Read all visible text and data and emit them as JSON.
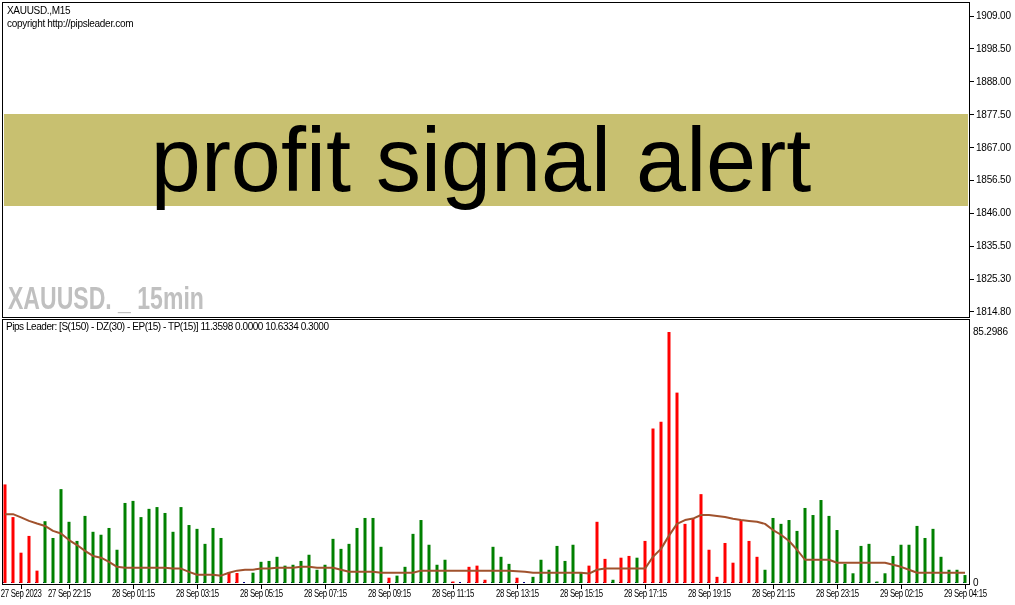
{
  "main_pane": {
    "symbol": "XAUUSD.,M15",
    "copyright": "copyright http://pipsleader.com",
    "banner": {
      "text": "profit signal alert"
    },
    "caption": "XAUUSD. _ 15min",
    "price_axis": {
      "labels": [
        "1909.00",
        "1898.50",
        "1888.00",
        "1877.50",
        "1867.00",
        "1856.50",
        "1846.00",
        "1835.50",
        "1825.30",
        "1814.80"
      ]
    }
  },
  "indicator_pane": {
    "label": "Pips Leader: [S(150) - DZ(30) - EP(15) - TP(15)] 11.3598 0.0000 10.6334 0.3000",
    "chart_data": {
      "type": "bar",
      "ylim": [
        -0.68,
        89.72
      ],
      "yticks": [
        {
          "value": 85.2986,
          "label": "85.2986"
        },
        {
          "value": 0,
          "label": "0"
        }
      ],
      "categories": [
        null,
        null,
        "27 Sep 2023",
        null,
        null,
        null,
        null,
        null,
        "27 Sep 22:15",
        null,
        null,
        null,
        null,
        null,
        null,
        null,
        "28 Sep 01:15",
        null,
        null,
        null,
        null,
        null,
        null,
        null,
        "28 Sep 03:15",
        null,
        null,
        null,
        null,
        null,
        null,
        null,
        "28 Sep 05:15",
        null,
        null,
        null,
        null,
        null,
        null,
        null,
        "28 Sep 07:15",
        null,
        null,
        null,
        null,
        null,
        null,
        null,
        "28 Sep 09:15",
        null,
        null,
        null,
        null,
        null,
        null,
        null,
        "28 Sep 11:15",
        null,
        null,
        null,
        null,
        null,
        null,
        null,
        "28 Sep 13:15",
        null,
        null,
        null,
        null,
        null,
        null,
        null,
        "28 Sep 15:15",
        null,
        null,
        null,
        null,
        null,
        null,
        null,
        "28 Sep 17:15",
        null,
        null,
        null,
        null,
        null,
        null,
        null,
        "28 Sep 19:15",
        null,
        null,
        null,
        null,
        null,
        null,
        null,
        "28 Sep 21:15",
        null,
        null,
        null,
        null,
        null,
        null,
        null,
        "28 Sep 23:15",
        null,
        null,
        null,
        null,
        null,
        null,
        null,
        "29 Sep 02:15",
        null,
        null,
        null,
        null,
        null,
        null,
        null,
        "29 Sep 04:15"
      ],
      "series": [
        {
          "type": "bar",
          "color": "#008000",
          "values": [
            null,
            null,
            null,
            null,
            null,
            21.0,
            15.3,
            31.9,
            20.8,
            14.3,
            22.8,
            17.4,
            16.4,
            18.7,
            11.3,
            27.2,
            27.9,
            22.4,
            25.2,
            25.8,
            23.8,
            17.4,
            25.8,
            19.7,
            18.4,
            13.3,
            18.7,
            15.3,
            null,
            null,
            null,
            3.5,
            7.2,
            7.5,
            8.9,
            5.9,
            6.2,
            7.5,
            9.6,
            4.5,
            6.2,
            15.0,
            11.6,
            13.3,
            18.7,
            22.1,
            22.1,
            12.3,
            null,
            2.5,
            5.5,
            16.7,
            21.4,
            13.0,
            6.2,
            7.9,
            null,
            null,
            null,
            null,
            null,
            12.3,
            8.9,
            6.5,
            null,
            null,
            2.1,
            7.9,
            4.5,
            12.6,
            7.5,
            13.0,
            3.5,
            null,
            null,
            null,
            1.1,
            null,
            null,
            8.6,
            null,
            null,
            null,
            null,
            null,
            null,
            null,
            null,
            null,
            null,
            null,
            null,
            null,
            null,
            null,
            4.5,
            22.1,
            20.1,
            21.4,
            17.7,
            25.5,
            23.1,
            28.2,
            22.8,
            18.0,
            6.5,
            3.3,
            12.6,
            13.3,
            0.5,
            3.3,
            9.2,
            13.0,
            13.0,
            19.4,
            15.3,
            18.4,
            8.9,
            4.5,
            4.5,
            2.7
          ]
        },
        {
          "type": "bar",
          "color": "#ff0000",
          "values": [
            33.5,
            22.4,
            10.3,
            16.0,
            4.2,
            null,
            null,
            null,
            null,
            null,
            null,
            null,
            null,
            null,
            null,
            null,
            null,
            null,
            null,
            null,
            null,
            null,
            null,
            null,
            null,
            null,
            null,
            null,
            3.7,
            3.4,
            null,
            null,
            null,
            null,
            null,
            null,
            null,
            null,
            null,
            null,
            null,
            null,
            null,
            null,
            null,
            null,
            null,
            null,
            1.8,
            null,
            null,
            null,
            null,
            null,
            null,
            null,
            0.5,
            null,
            5.5,
            5.9,
            1.1,
            null,
            null,
            null,
            1.8,
            null,
            null,
            null,
            null,
            null,
            null,
            null,
            null,
            5.9,
            20.8,
            8.2,
            null,
            8.6,
            9.2,
            null,
            14.3,
            52.5,
            54.8,
            85.3,
            64.7,
            20.1,
            21.8,
            30.2,
            11.3,
            2.1,
            13.6,
            6.9,
            21.4,
            14.3,
            8.9,
            null,
            null,
            null,
            null,
            null,
            null,
            null,
            null,
            null,
            null,
            null,
            null,
            null,
            null,
            null,
            null,
            null,
            null,
            null,
            null,
            null,
            null,
            null,
            null,
            null,
            null
          ]
        },
        {
          "type": "line",
          "color": "#a0522d",
          "values": [
            23.4,
            23.4,
            22.3,
            21.1,
            20.2,
            19.4,
            17.7,
            16.8,
            14.6,
            12.9,
            10.9,
            9.2,
            8.6,
            7.2,
            5.5,
            5.2,
            5.2,
            5.2,
            5.2,
            5.2,
            5.2,
            4.9,
            4.9,
            3.8,
            2.8,
            2.8,
            2.8,
            2.5,
            3.5,
            4.2,
            4.5,
            4.5,
            4.9,
            4.9,
            5.2,
            5.2,
            5.2,
            5.5,
            5.5,
            5.2,
            5.2,
            5.2,
            4.5,
            3.8,
            3.8,
            3.8,
            3.8,
            3.5,
            3.5,
            3.5,
            3.5,
            3.5,
            4.2,
            4.2,
            4.2,
            4.2,
            4.2,
            4.2,
            4.2,
            4.2,
            4.2,
            4.2,
            4.2,
            4.2,
            4.0,
            3.8,
            3.5,
            3.5,
            3.5,
            3.5,
            3.5,
            3.5,
            3.5,
            3.2,
            4.5,
            4.9,
            4.9,
            4.9,
            4.9,
            4.9,
            4.9,
            8.9,
            11.6,
            16.1,
            20.1,
            21.4,
            21.9,
            23.1,
            23.1,
            22.8,
            22.4,
            21.8,
            21.4,
            21.1,
            20.8,
            20.1,
            18.0,
            16.4,
            14.3,
            11.3,
            7.9,
            7.9,
            7.9,
            7.9,
            6.9,
            6.9,
            6.9,
            6.9,
            6.9,
            6.9,
            6.9,
            6.2,
            5.5,
            4.5,
            3.5,
            3.5,
            3.5,
            3.5,
            3.5,
            3.5,
            3.5
          ]
        }
      ]
    }
  }
}
